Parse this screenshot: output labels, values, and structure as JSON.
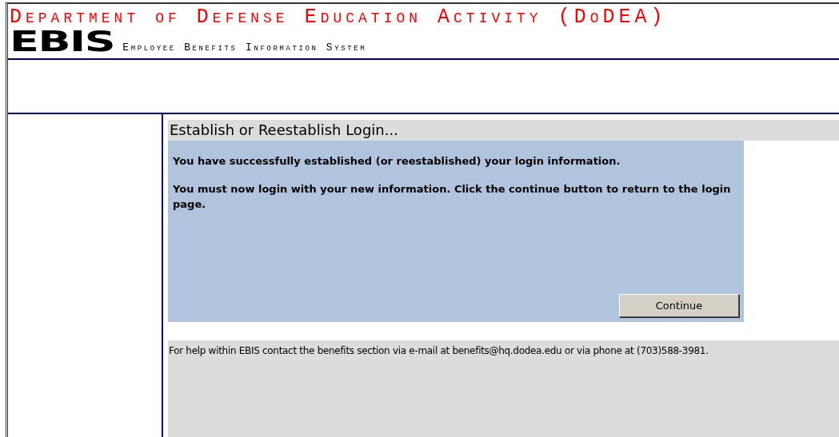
{
  "header": {
    "agency": "Department of Defense Education Activity (DoDEA)",
    "logo": "EBIS",
    "system_name": "Employee Benefits Information System"
  },
  "panel": {
    "title": "Establish or Reestablish Login...",
    "messages": [
      "You have successfully established (or reestablished) your login information.",
      "You must now login with your new information. Click the continue button to return to the login page."
    ],
    "button": "Continue"
  },
  "help": "For help within EBIS contact the benefits section via e-mail at benefits@hq.dodea.edu or via phone at (703)588-3981."
}
